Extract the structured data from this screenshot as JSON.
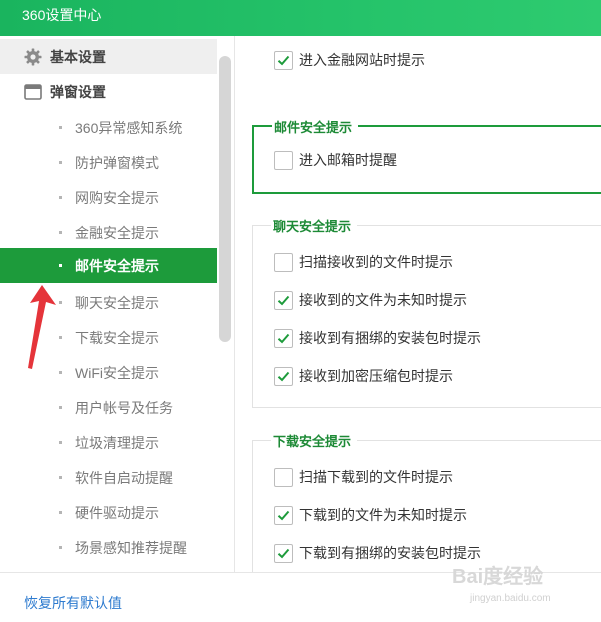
{
  "app": {
    "title": "360设置中心"
  },
  "sidebar": {
    "top_items": [
      {
        "label": "基本设置",
        "icon": "gear-icon"
      },
      {
        "label": "弹窗设置",
        "icon": "window-icon"
      }
    ],
    "sub_items": [
      {
        "label": "360异常感知系统"
      },
      {
        "label": "防护弹窗模式"
      },
      {
        "label": "网购安全提示"
      },
      {
        "label": "金融安全提示"
      },
      {
        "label": "邮件安全提示",
        "active": true
      },
      {
        "label": "聊天安全提示"
      },
      {
        "label": "下载安全提示"
      },
      {
        "label": "WiFi安全提示"
      },
      {
        "label": "用户帐号及任务"
      },
      {
        "label": "垃圾清理提示"
      },
      {
        "label": "软件自启动提醒"
      },
      {
        "label": "硬件驱动提示"
      },
      {
        "label": "场景感知推荐提醒"
      }
    ]
  },
  "main": {
    "finance": {
      "items": [
        {
          "label": "进入金融网站时提示",
          "checked": true
        }
      ]
    },
    "mail": {
      "title": "邮件安全提示",
      "items": [
        {
          "label": "进入邮箱时提醒",
          "checked": false
        }
      ]
    },
    "chat": {
      "title": "聊天安全提示",
      "items": [
        {
          "label": "扫描接收到的文件时提示",
          "checked": false
        },
        {
          "label": "接收到的文件为未知时提示",
          "checked": true
        },
        {
          "label": "接收到有捆绑的安装包时提示",
          "checked": true
        },
        {
          "label": "接收到加密压缩包时提示",
          "checked": true
        }
      ]
    },
    "download": {
      "title": "下载安全提示",
      "items": [
        {
          "label": "扫描下载到的文件时提示",
          "checked": false
        },
        {
          "label": "下载到的文件为未知时提示",
          "checked": true
        },
        {
          "label": "下载到有捆绑的安装包时提示",
          "checked": true
        }
      ]
    }
  },
  "footer": {
    "restore_label": "恢复所有默认值"
  },
  "watermark": {
    "text": "Bai度经验",
    "sub": "jingyan.baidu.com"
  },
  "colors": {
    "accent": "#1d9b3b",
    "title_bar": "#25c36a",
    "link": "#2e7bcf"
  }
}
